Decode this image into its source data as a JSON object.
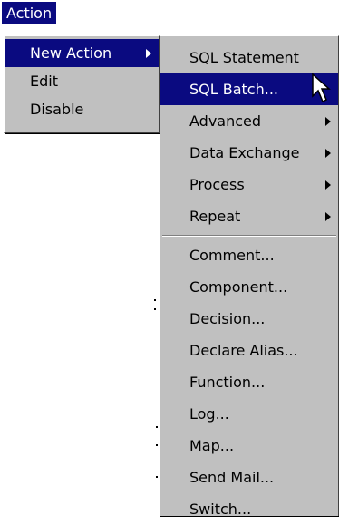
{
  "menubar": {
    "title": "Action"
  },
  "menu_level1": {
    "items": [
      {
        "label": "New Action",
        "highlighted": true,
        "submenu": true
      },
      {
        "label": "Edit",
        "highlighted": false,
        "submenu": false
      },
      {
        "label": "Disable",
        "highlighted": false,
        "submenu": false
      }
    ]
  },
  "menu_level2": {
    "group1": [
      {
        "label": "SQL Statement",
        "submenu": false
      },
      {
        "label": "SQL Batch...",
        "submenu": false,
        "highlighted": true
      },
      {
        "label": "Advanced",
        "submenu": true
      },
      {
        "label": "Data Exchange",
        "submenu": true
      },
      {
        "label": "Process",
        "submenu": true
      },
      {
        "label": "Repeat",
        "submenu": true
      }
    ],
    "group2": [
      {
        "label": "Comment..."
      },
      {
        "label": "Component..."
      },
      {
        "label": "Decision..."
      },
      {
        "label": "Declare Alias..."
      },
      {
        "label": "Function..."
      },
      {
        "label": "Log..."
      },
      {
        "label": "Map..."
      },
      {
        "label": "Send Mail..."
      },
      {
        "label": "Switch..."
      }
    ]
  },
  "colors": {
    "highlight": "#0a0a80",
    "menu_bg": "#c0c0c0"
  }
}
